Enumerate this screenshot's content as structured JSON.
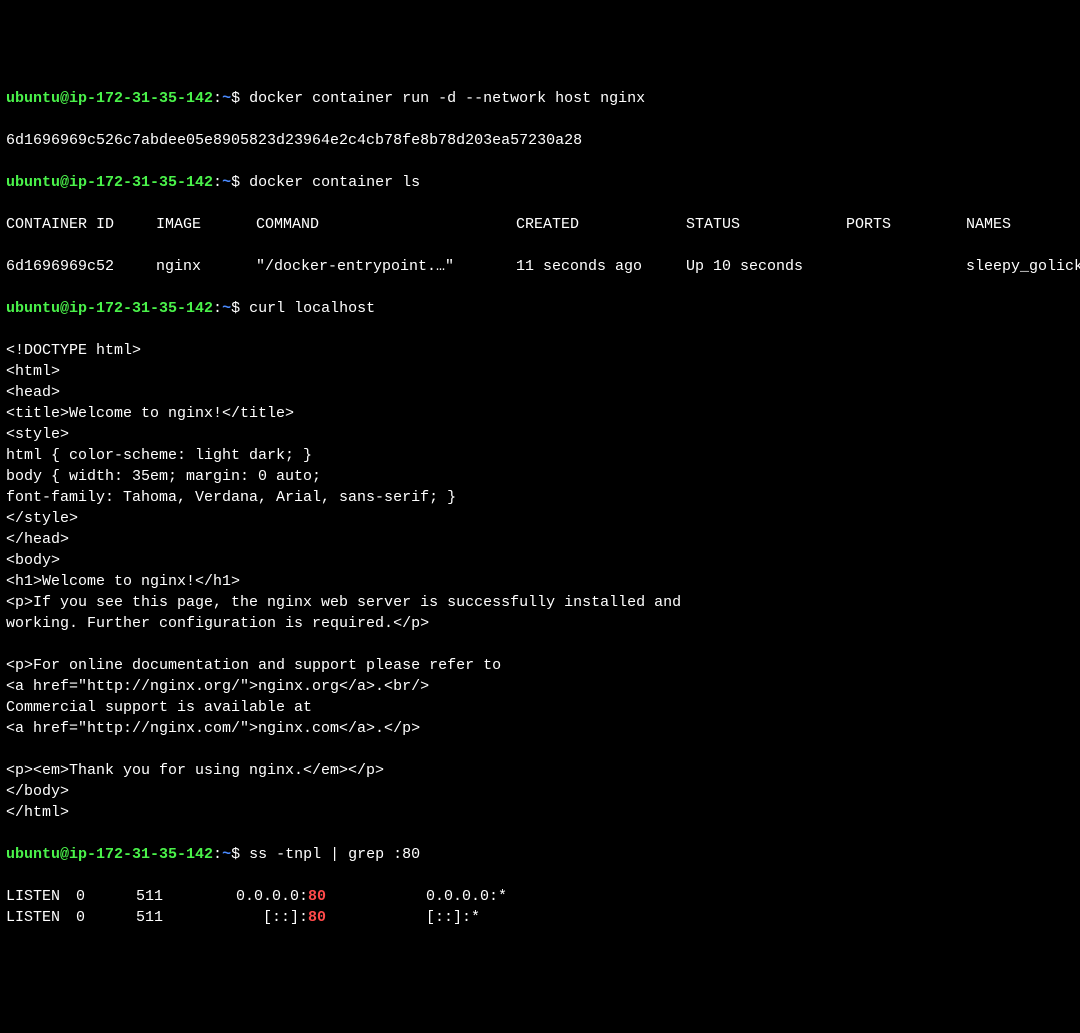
{
  "prompt": {
    "userhost": "ubuntu@ip-172-31-35-142",
    "sep": ":",
    "path": "~",
    "symbol": "$"
  },
  "cmd1": "docker container run -d --network host nginx",
  "out1": "6d1696969c526c7abdee05e8905823d23964e2c4cb78fe8b78d203ea57230a28",
  "cmd2": "docker container ls",
  "table": {
    "headers": {
      "id": "CONTAINER ID",
      "image": "IMAGE",
      "cmd": "COMMAND",
      "created": "CREATED",
      "status": "STATUS",
      "ports": "PORTS",
      "names": "NAMES"
    },
    "row": {
      "id": "6d1696969c52",
      "image": "nginx",
      "cmd": "\"/docker-entrypoint.…\"",
      "created": "11 seconds ago",
      "status": "Up 10 seconds",
      "ports": "",
      "names": "sleepy_golick"
    }
  },
  "cmd3": "curl localhost",
  "curl_output": [
    "<!DOCTYPE html>",
    "<html>",
    "<head>",
    "<title>Welcome to nginx!</title>",
    "<style>",
    "html { color-scheme: light dark; }",
    "body { width: 35em; margin: 0 auto;",
    "font-family: Tahoma, Verdana, Arial, sans-serif; }",
    "</style>",
    "</head>",
    "<body>",
    "<h1>Welcome to nginx!</h1>",
    "<p>If you see this page, the nginx web server is successfully installed and",
    "working. Further configuration is required.</p>",
    "",
    "<p>For online documentation and support please refer to",
    "<a href=\"http://nginx.org/\">nginx.org</a>.<br/>",
    "Commercial support is available at",
    "<a href=\"http://nginx.com/\">nginx.com</a>.</p>",
    "",
    "<p><em>Thank you for using nginx.</em></p>",
    "</body>",
    "</html>"
  ],
  "cmd4": "ss -tnpl | grep :80",
  "ss": [
    {
      "state": "LISTEN",
      "recv": "0",
      "send": "511",
      "local_pre": "0.0.0.0:",
      "local_port": "80",
      "peer": "0.0.0.0:*"
    },
    {
      "state": "LISTEN",
      "recv": "0",
      "send": "511",
      "local_pre": "[::]:",
      "local_port": "80",
      "peer": "[::]:*"
    }
  ]
}
